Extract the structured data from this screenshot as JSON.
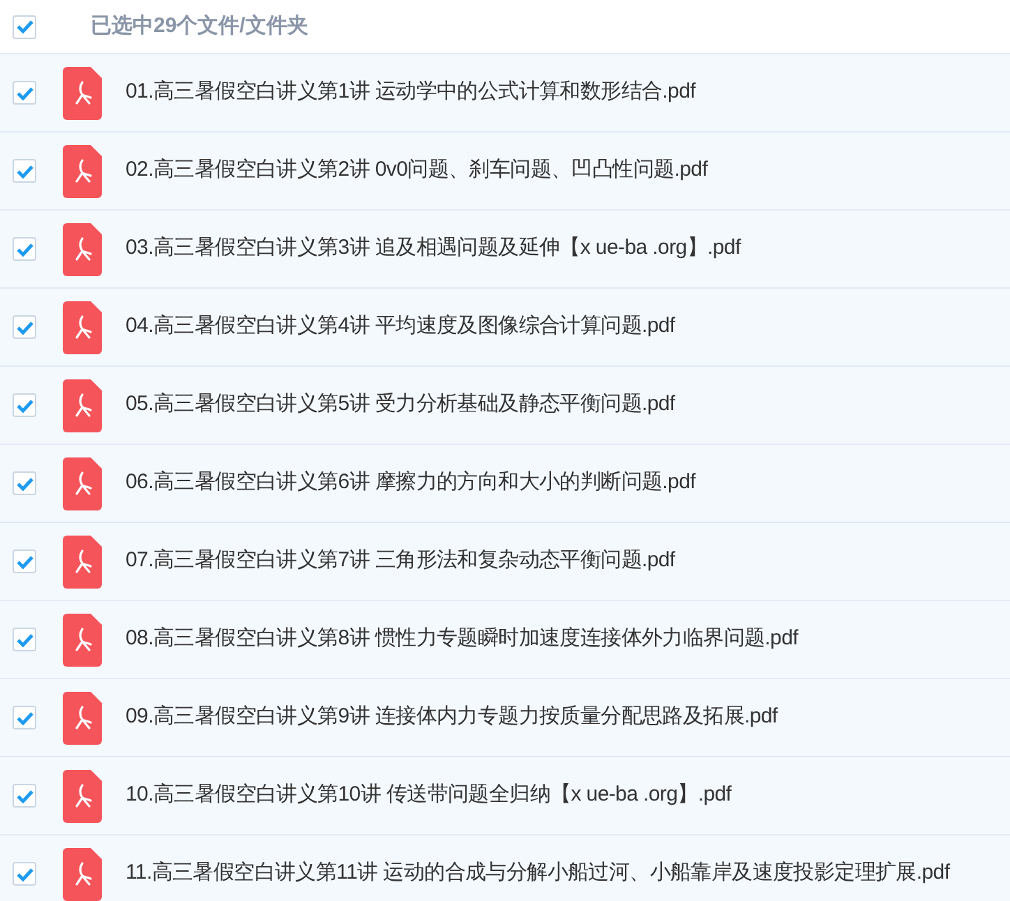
{
  "header": {
    "checked": true,
    "label": "已选中29个文件/文件夹"
  },
  "files": [
    {
      "name": "01.高三暑假空白讲义第1讲 运动学中的公式计算和数形结合.pdf",
      "checked": true
    },
    {
      "name": "02.高三暑假空白讲义第2讲 0v0问题、刹车问题、凹凸性问题.pdf",
      "checked": true
    },
    {
      "name": "03.高三暑假空白讲义第3讲 追及相遇问题及延伸【x ue-ba .org】.pdf",
      "checked": true
    },
    {
      "name": "04.高三暑假空白讲义第4讲 平均速度及图像综合计算问题.pdf",
      "checked": true
    },
    {
      "name": "05.高三暑假空白讲义第5讲 受力分析基础及静态平衡问题.pdf",
      "checked": true
    },
    {
      "name": "06.高三暑假空白讲义第6讲 摩擦力的方向和大小的判断问题.pdf",
      "checked": true
    },
    {
      "name": "07.高三暑假空白讲义第7讲 三角形法和复杂动态平衡问题.pdf",
      "checked": true
    },
    {
      "name": "08.高三暑假空白讲义第8讲 惯性力专题瞬时加速度连接体外力临界问题.pdf",
      "checked": true
    },
    {
      "name": "09.高三暑假空白讲义第9讲 连接体内力专题力按质量分配思路及拓展.pdf",
      "checked": true
    },
    {
      "name": "10.高三暑假空白讲义第10讲 传送带问题全归纳【x ue-ba .org】.pdf",
      "checked": true
    },
    {
      "name": "11.高三暑假空白讲义第11讲 运动的合成与分解小船过河、小船靠岸及速度投影定理扩展.pdf",
      "checked": true
    }
  ]
}
